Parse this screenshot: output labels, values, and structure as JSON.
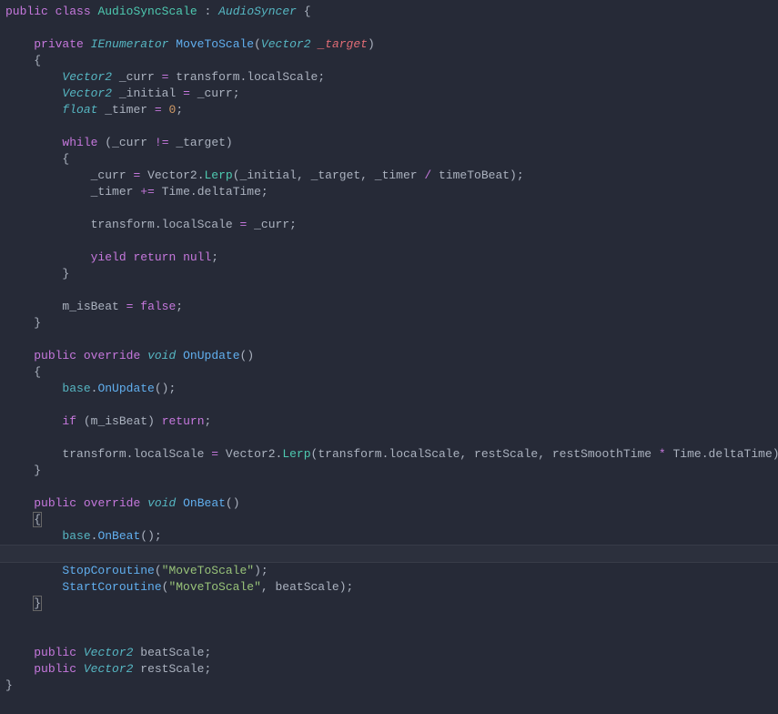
{
  "language": "csharp",
  "class_decl": {
    "access": "public",
    "kw_class": "class",
    "name": "AudioSyncScale",
    "colon": ":",
    "base": "AudioSyncer"
  },
  "move_to_scale": {
    "access": "private",
    "ret": "IEnumerator",
    "name": "MoveToScale",
    "param_type": "Vector2",
    "param_name": "_target",
    "l_curr_decl_type": "Vector2",
    "l_curr_decl_name": "_curr",
    "l_curr_decl_rhs1": "transform",
    "l_curr_decl_rhs2": "localScale",
    "l_init_type": "Vector2",
    "l_init_name": "_initial",
    "l_init_rhs": "_curr",
    "l_timer_type": "float",
    "l_timer_name": "_timer",
    "l_timer_val": "0",
    "while_kw": "while",
    "while_lhs": "_curr",
    "while_op": "!=",
    "while_rhs": "_target",
    "lerp_lhs": "_curr",
    "lerp_obj": "Vector2",
    "lerp_fn": "Lerp",
    "lerp_a1": "_initial",
    "lerp_a2": "_target",
    "lerp_a3": "_timer",
    "lerp_div": "/",
    "lerp_a4": "timeToBeat",
    "timer_inc_lhs": "_timer",
    "timer_inc_op": "+=",
    "timer_inc_r1": "Time",
    "timer_inc_r2": "deltaTime",
    "scale_lhs1": "transform",
    "scale_lhs2": "localScale",
    "scale_rhs": "_curr",
    "yield": "yield",
    "return": "return",
    "null": "null",
    "isbeat": "m_isBeat",
    "false": "false"
  },
  "on_update": {
    "access": "public",
    "override": "override",
    "ret": "void",
    "name": "OnUpdate",
    "base": "base",
    "call": "OnUpdate",
    "if": "if",
    "cond": "m_isBeat",
    "return": "return",
    "l1": "transform",
    "l2": "localScale",
    "r_obj": "Vector2",
    "r_fn": "Lerp",
    "a1a": "transform",
    "a1b": "localScale",
    "a2": "restScale",
    "a3": "restSmoothTime",
    "star": "*",
    "a4a": "Time",
    "a4b": "deltaTime"
  },
  "on_beat": {
    "access": "public",
    "override": "override",
    "ret": "void",
    "name": "OnBeat",
    "base": "base",
    "call": "OnBeat",
    "stop_fn": "StopCoroutine",
    "stop_arg": "\"MoveToScale\"",
    "start_fn": "StartCoroutine",
    "start_arg1": "\"MoveToScale\"",
    "start_arg2": "beatScale"
  },
  "fields": {
    "f1_access": "public",
    "f1_type": "Vector2",
    "f1_name": "beatScale",
    "f2_access": "public",
    "f2_type": "Vector2",
    "f2_name": "restScale"
  }
}
